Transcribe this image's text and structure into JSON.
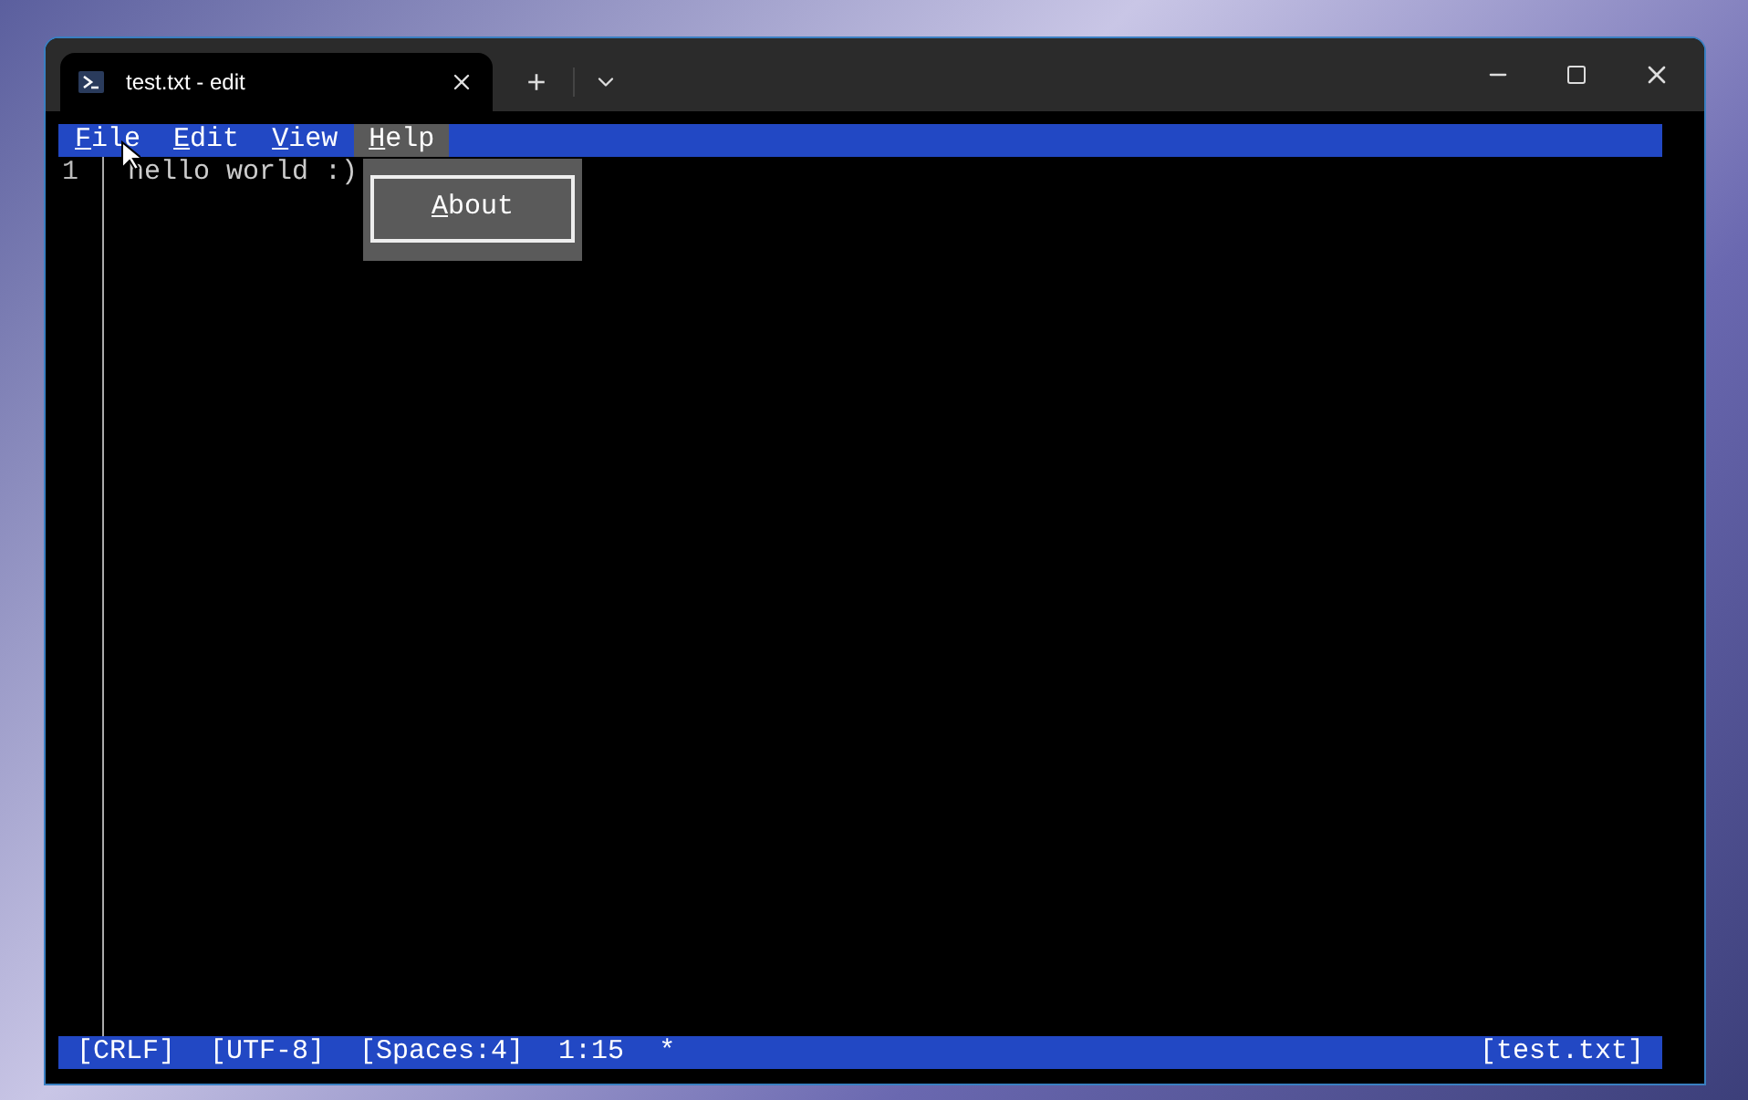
{
  "window": {
    "tab_title": "test.txt - edit",
    "new_tab": "+"
  },
  "menu_bar": [
    {
      "label": "File",
      "selected": false
    },
    {
      "label": "Edit",
      "selected": false
    },
    {
      "label": "View",
      "selected": false
    },
    {
      "label": "Help",
      "selected": true
    }
  ],
  "dropdown": {
    "items": [
      "About"
    ]
  },
  "editor": {
    "lines": [
      {
        "number": "1",
        "text": "hello world :)"
      }
    ]
  },
  "status_bar": {
    "left": [
      "[CRLF]",
      "[UTF-8]",
      "[Spaces:4]",
      "1:15",
      "*"
    ],
    "right": "[test.txt]"
  }
}
